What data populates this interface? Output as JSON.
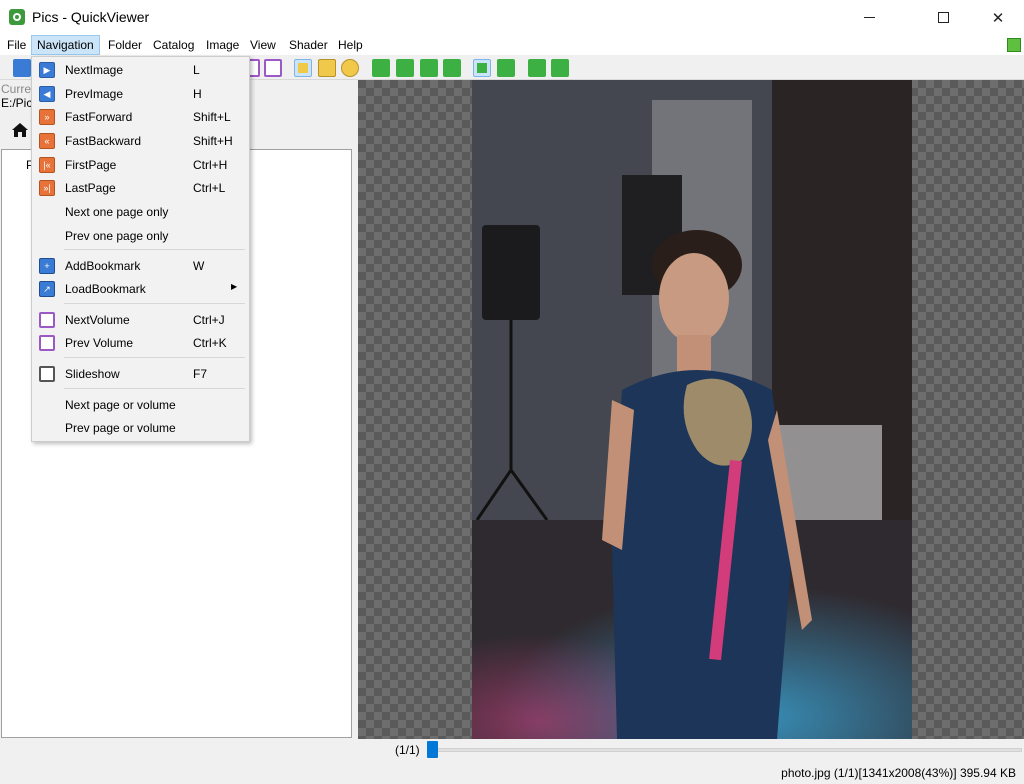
{
  "window": {
    "title": "Pics - QuickViewer",
    "minimize_glyph": "",
    "close_glyph": "✕"
  },
  "menubar": {
    "items": [
      {
        "label": "File"
      },
      {
        "label": "Navigation"
      },
      {
        "label": "Folder"
      },
      {
        "label": "Catalog"
      },
      {
        "label": "Image"
      },
      {
        "label": "View"
      },
      {
        "label": "Shader"
      },
      {
        "label": "Help"
      }
    ]
  },
  "left_panel": {
    "current_label": "Curre",
    "current_path": "E:/Pic",
    "tree_item": "P"
  },
  "navigation_menu": {
    "items": [
      {
        "label": "NextImage",
        "shortcut": "L",
        "icon": "next-image-icon"
      },
      {
        "label": "PrevImage",
        "shortcut": "H",
        "icon": "prev-image-icon"
      },
      {
        "label": "FastForward",
        "shortcut": "Shift+L",
        "icon": "fast-forward-icon"
      },
      {
        "label": "FastBackward",
        "shortcut": "Shift+H",
        "icon": "fast-backward-icon"
      },
      {
        "label": "FirstPage",
        "shortcut": "Ctrl+H",
        "icon": "first-page-icon"
      },
      {
        "label": "LastPage",
        "shortcut": "Ctrl+L",
        "icon": "last-page-icon"
      },
      {
        "label": "Next one page only",
        "shortcut": "",
        "icon": ""
      },
      {
        "label": "Prev one page only",
        "shortcut": "",
        "icon": ""
      },
      {
        "label": "AddBookmark",
        "shortcut": "W",
        "icon": "add-bookmark-icon"
      },
      {
        "label": "LoadBookmark",
        "shortcut": "",
        "icon": "load-bookmark-icon",
        "submenu": true
      },
      {
        "label": "NextVolume",
        "shortcut": "Ctrl+J",
        "icon": "next-volume-icon"
      },
      {
        "label": "Prev Volume",
        "shortcut": "Ctrl+K",
        "icon": "prev-volume-icon"
      },
      {
        "label": "Slideshow",
        "shortcut": "F7",
        "icon": "slideshow-icon"
      },
      {
        "label": "Next page or volume",
        "shortcut": "",
        "icon": ""
      },
      {
        "label": "Prev page or volume",
        "shortcut": "",
        "icon": ""
      }
    ],
    "submenu_arrow": "▶"
  },
  "pagebar": {
    "page_count": "(1/1)"
  },
  "statusbar": {
    "text": "photo.jpg (1/1)[1341x2008(43%)] 395.94 KB"
  },
  "colors": {
    "accent": "#0078d7",
    "menu_highlight": "#cce4f7"
  }
}
